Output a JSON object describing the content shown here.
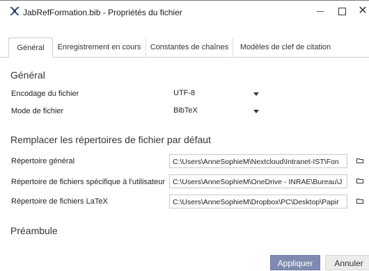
{
  "window": {
    "title": "JabRefFormation.bib - Propriétés du fichier",
    "close_glyph": "✕"
  },
  "tabs": [
    {
      "label": "Général",
      "active": true
    },
    {
      "label": "Enregistrement en cours",
      "active": false
    },
    {
      "label": "Constantes de chaînes",
      "active": false
    },
    {
      "label": "Modèles de clef de citation",
      "active": false
    }
  ],
  "general": {
    "heading": "Général",
    "encoding_label": "Encodage du fichier",
    "encoding_value": "UTF-8",
    "mode_label": "Mode de fichier",
    "mode_value": "BibTeX"
  },
  "directories": {
    "heading": "Remplacer les répertoires de fichier par défaut",
    "general_label": "Répertoire général",
    "general_value": "C:\\Users\\AnneSophieM\\Nextcloud\\Intranet-IST\\Fon",
    "user_label": "Répertoire de fichiers spécifique à l'utilisateur",
    "user_value": "C:\\Users\\AnneSophieM\\OneDrive - INRAE\\Bureau\\J",
    "latex_label": "Répertoire de fichiers LaTeX",
    "latex_value": "C:\\Users\\AnneSophieM\\Dropbox\\PC\\Desktop\\Papir"
  },
  "preamble": {
    "heading": "Préambule"
  },
  "buttons": {
    "apply": "Appliquer",
    "cancel": "Annuler"
  },
  "colors": {
    "apply_bg": "#7e8ab1",
    "app_icon": "#3d4f8c"
  }
}
